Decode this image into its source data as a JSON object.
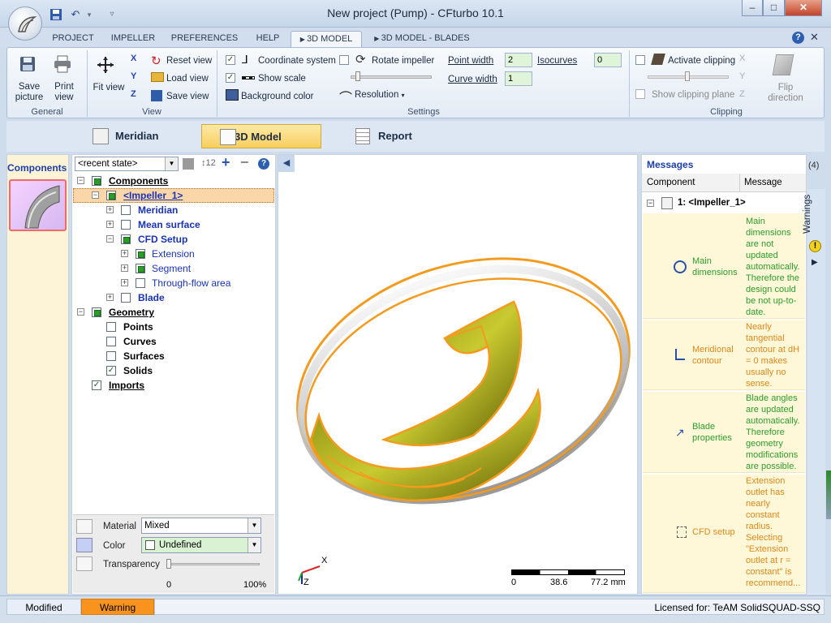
{
  "window": {
    "title": "New project (Pump) - CFturbo 10.1",
    "min_label": "–",
    "max_label": "□",
    "close_label": "✕"
  },
  "tabs": [
    "PROJECT",
    "IMPELLER",
    "PREFERENCES",
    "HELP",
    "3D MODEL",
    "3D MODEL - BLADES"
  ],
  "ribbon": {
    "general": {
      "label": "General",
      "save_picture": "Save picture",
      "print_view": "Print view"
    },
    "view": {
      "label": "View",
      "fit_view": "Fit view",
      "reset_view": "Reset view",
      "load_view": "Load view",
      "save_view": "Save view",
      "axis_x": "X",
      "axis_y": "Y",
      "axis_z": "Z"
    },
    "settings": {
      "label": "Settings",
      "coordinate_system": "Coordinate system",
      "show_scale": "Show scale",
      "background_color": "Background color",
      "rotate_impeller": "Rotate impeller",
      "resolution": "Resolution",
      "point_width_label": "Point width",
      "point_width_value": "2",
      "curve_width_label": "Curve width",
      "curve_width_value": "1",
      "isocurves_label": "Isocurves",
      "isocurves_value": "0"
    },
    "clipping": {
      "label": "Clipping",
      "activate_clipping": "Activate clipping",
      "show_clipping_plane": "Show clipping plane",
      "flip_direction": "Flip direction"
    }
  },
  "viewbar": {
    "meridian": "Meridian",
    "model3d": "3D Model",
    "report": "Report"
  },
  "components_title": "Components",
  "tree": {
    "state_select": "<recent state>",
    "counter": "12",
    "rows": [
      {
        "label": "Components",
        "checked": true
      },
      {
        "label": "<Impeller_1>",
        "checked": true
      },
      {
        "label": "Meridian",
        "checked": false
      },
      {
        "label": "Mean surface",
        "checked": false
      },
      {
        "label": "CFD Setup",
        "checked": true
      },
      {
        "label": "Extension",
        "checked": true
      },
      {
        "label": "Segment",
        "checked": true
      },
      {
        "label": "Through-flow area",
        "checked": false
      },
      {
        "label": "Blade",
        "checked": false
      },
      {
        "label": "Geometry",
        "checked": true
      },
      {
        "label": "Points",
        "checked": false
      },
      {
        "label": "Curves",
        "checked": false
      },
      {
        "label": "Surfaces",
        "checked": false
      },
      {
        "label": "Solids",
        "checked": true
      },
      {
        "label": "Imports",
        "checked": true
      }
    ]
  },
  "properties": {
    "material_label": "Material",
    "material_value": "Mixed",
    "color_label": "Color",
    "color_value": "Undefined",
    "transparency_label": "Transparency",
    "transparency_min": "0",
    "transparency_max": "100%",
    "transparency_level": 0
  },
  "viewport": {
    "axis_x": "X",
    "axis_z": "Z",
    "scale": {
      "s0": "0",
      "s1": "38.6",
      "s2": "77.2 mm"
    }
  },
  "messages": {
    "title": "Messages",
    "count": "(4)",
    "col_component": "Component",
    "col_message": "Message",
    "root": "1: <Impeller_1>",
    "warnings_label": "Warnings",
    "items": [
      {
        "component": "Main dimensions",
        "text": "Main dimensions are not updated automatically. Therefore the design could be not up-to-date.",
        "color": "#2c9d2c"
      },
      {
        "component": "Meridional contour",
        "text": "Nearly tangential contour at dH = 0 makes usually no sense.",
        "color": "#e0871a"
      },
      {
        "component": "Blade properties",
        "text": "Blade angles are updated automatically. Therefore geometry modifications are possible.",
        "color": "#2c9d2c"
      },
      {
        "component": "CFD setup",
        "text": "Extension outlet has nearly constant radius. Selecting \"Extension outlet at r = constant\" is recommend...",
        "color": "#e0871a"
      }
    ]
  },
  "status": {
    "modified": "Modified",
    "warning": "Warning",
    "license": "Licensed for: TeAM SolidSQUAD-SSQ"
  },
  "colors": {
    "warning_orange": "#f7931e",
    "ok_green": "#2c9d2c",
    "link_blue": "#1a33b5"
  }
}
